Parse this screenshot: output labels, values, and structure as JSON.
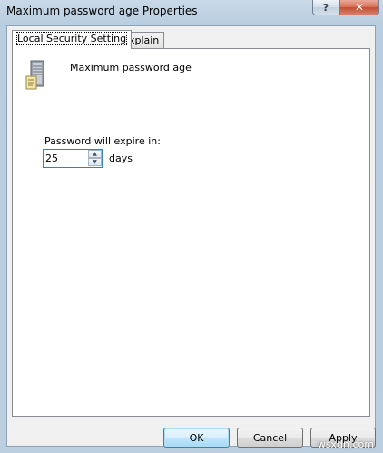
{
  "window": {
    "title": "Maximum password age Properties",
    "help_glyph": "?",
    "close_glyph": "✕"
  },
  "tabs": [
    {
      "label": "Local Security Setting",
      "active": true
    },
    {
      "label": "Explain",
      "active": false
    }
  ],
  "policy": {
    "icon": "server-policy-icon",
    "name": "Maximum password age"
  },
  "setting": {
    "label": "Password will expire in:",
    "value": "25",
    "units": "days"
  },
  "buttons": {
    "ok": "OK",
    "cancel": "Cancel",
    "apply": "Apply"
  },
  "watermark": "wsxdn.com",
  "colors": {
    "title_bar": "#c9d9e8",
    "close_button": "#c64b33",
    "focus_accent": "#3c7fb1"
  }
}
